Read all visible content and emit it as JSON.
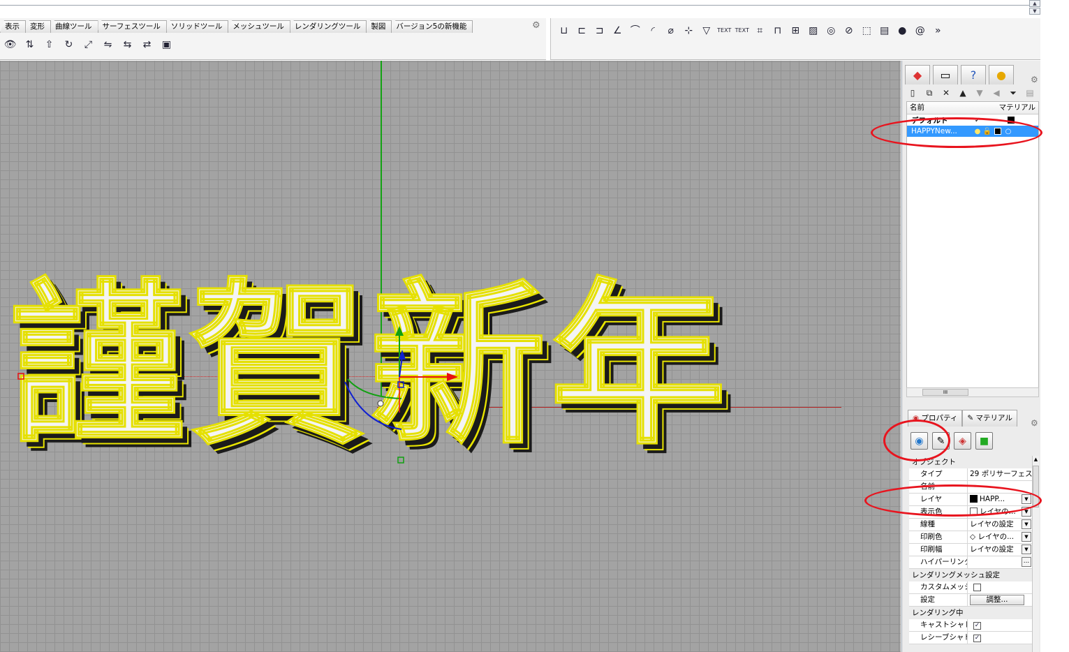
{
  "toolbar_tabs": [
    "表示",
    "変形",
    "曲線ツール",
    "サーフェスツール",
    "ソリッドツール",
    "メッシュツール",
    "レンダリングツール",
    "製図",
    "バージョン5の新機能"
  ],
  "toolbar_icons": [
    "eye-icon",
    "flip-icon",
    "move-up-icon",
    "rotate-icon",
    "scale-icon",
    "mirror-icon",
    "array-icon",
    "orient-icon",
    "bounding-box-icon"
  ],
  "right_toolbar_icons": [
    "dimension-linear-icon",
    "dimension-aligned-icon",
    "dimension-rotated-icon",
    "dimension-angle-icon",
    "dimension-arc-icon",
    "dimension-radius-icon",
    "dimension-diameter-icon",
    "dimension-ordinate-icon",
    "leader-icon",
    "text-icon",
    "text-tag-icon",
    "text-block-icon",
    "balloon-icon",
    "detail-icon",
    "hatch-icon",
    "clipping-icon",
    "section-icon",
    "box-icon",
    "layer-icon",
    "sphere-icon",
    "spiral-icon"
  ],
  "right_toolbar_text": {
    "text1": "TEXT",
    "text2": "TEXT",
    "overflow": "»"
  },
  "viewport": {
    "text_object": [
      "謹",
      "賀",
      "新",
      "年"
    ]
  },
  "layers_panel": {
    "tab_icons": [
      "layers-icon",
      "display-icon",
      "help-icon",
      "render-icon"
    ],
    "tool_icons": [
      "new-layer-icon",
      "copy-layer-icon",
      "delete-icon",
      "move-up-icon",
      "move-down-icon",
      "back-icon",
      "filter-icon",
      "tool-icon"
    ],
    "header": {
      "name": "名前",
      "material": "マテリアル"
    },
    "rows": [
      {
        "name": "デフォルト",
        "check": "✓",
        "selected": false
      },
      {
        "name": "HAPPYNew...",
        "selected": true
      }
    ],
    "scroll_thumb": "III"
  },
  "properties_panel": {
    "tabs": [
      "プロパティ",
      "マテリアル"
    ],
    "icons": [
      "object-properties-icon",
      "material-brush-icon",
      "texture-mapping-icon",
      "decal-icon"
    ],
    "section_object": "オブジェクト",
    "rows": [
      {
        "label": "タイプ",
        "value": "29 ポリサーフェス",
        "dropdown": false
      },
      {
        "label": "名前",
        "value": "",
        "dropdown": false
      },
      {
        "label": "レイヤ",
        "value": "HAPP...",
        "dropdown": true,
        "swatch": true
      },
      {
        "label": "表示色",
        "value": "レイヤの...",
        "dropdown": true,
        "swatch_outline": true
      },
      {
        "label": "線種",
        "value": "レイヤの設定",
        "dropdown": true
      },
      {
        "label": "印刷色",
        "value": "◇ レイヤの...",
        "dropdown": true
      },
      {
        "label": "印刷幅",
        "value": "レイヤの設定",
        "dropdown": true
      },
      {
        "label": "ハイパーリンク",
        "value": "",
        "button": "..."
      }
    ],
    "section_render_mesh": "レンダリングメッシュ設定",
    "custom_mesh_label": "カスタムメッシュ",
    "settings_label": "設定",
    "adjust_button": "調整...",
    "section_rendering": "レンダリング中",
    "cast_shadow_label": "キャストシャドウ",
    "receive_shadow_label": "レシーブシャドウ",
    "check_mark": "✓"
  },
  "colors": {
    "grid": "#a3a3a3",
    "yellow": "#e5e000",
    "annotation": "#e8141e",
    "selection": "#3399ff"
  }
}
